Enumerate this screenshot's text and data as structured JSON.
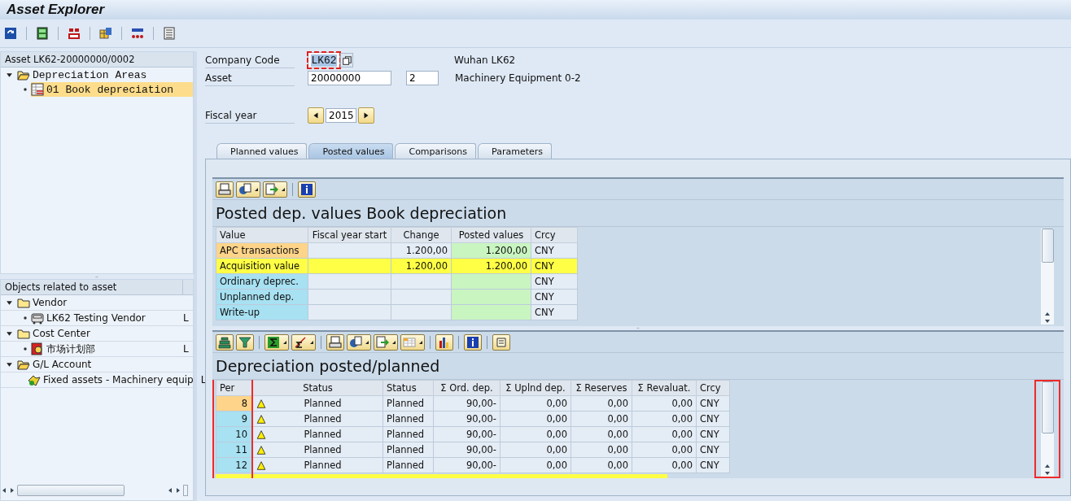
{
  "window": {
    "title": "Asset Explorer"
  },
  "asset_tree": {
    "header": "Asset LK62-20000000/0002",
    "items": [
      {
        "label": "Depreciation Areas",
        "kind": "folder-open",
        "expanded": true,
        "selected": false,
        "children": [
          {
            "label": "01 Book depreciation",
            "kind": "table",
            "selected": true
          }
        ]
      }
    ]
  },
  "related_tree": {
    "header": "Objects related to asset",
    "items": [
      {
        "label": "Vendor",
        "kind": "folder",
        "expanded": true,
        "children": [
          {
            "label": "LK62 Testing Vendor",
            "kind": "vendor",
            "column_2": "L"
          }
        ]
      },
      {
        "label": "Cost Center",
        "kind": "folder",
        "expanded": true,
        "children": [
          {
            "label": "市场计划部",
            "kind": "cost-center",
            "column_2": "L"
          }
        ]
      },
      {
        "label": "G/L Account",
        "kind": "folder-open",
        "expanded": true,
        "children": [
          {
            "label": "Fixed assets - Machinery equip",
            "kind": "account",
            "column_2": "L"
          }
        ]
      }
    ]
  },
  "company_code": {
    "label": "Company Code",
    "value": "LK62",
    "focused": true,
    "description": "Wuhan LK62"
  },
  "asset": {
    "label": "Asset",
    "value": "20000000",
    "subnumber": "2",
    "description": "Machinery Equipment 0-2"
  },
  "fiscal_year": {
    "label": "Fiscal year",
    "value": "2015"
  },
  "tabs": [
    {
      "label": "Planned values",
      "selected": false
    },
    {
      "label": "Posted values",
      "selected": true
    },
    {
      "label": "Comparisons",
      "selected": false
    },
    {
      "label": "Parameters",
      "selected": false
    }
  ],
  "posted_grid": {
    "title": "Posted dep. values Book depreciation",
    "columns": [
      {
        "label": "Value",
        "kind": "key"
      },
      {
        "label": "Fiscal year start",
        "kind": "number"
      },
      {
        "label": "Change",
        "kind": "number"
      },
      {
        "label": "Posted values",
        "kind": "result"
      },
      {
        "label": "Crcy",
        "kind": "text"
      }
    ],
    "rows": [
      {
        "kind": "normal",
        "selected": true,
        "cells": [
          "APC transactions",
          "",
          "1.200,00",
          "1.200,00",
          "CNY"
        ]
      },
      {
        "kind": "total",
        "selected": false,
        "cells": [
          "Acquisition value",
          "",
          "1.200,00",
          "1.200,00",
          "CNY"
        ]
      },
      {
        "kind": "normal",
        "selected": false,
        "cells": [
          "Ordinary deprec.",
          "",
          "",
          "",
          "CNY"
        ]
      },
      {
        "kind": "normal",
        "selected": false,
        "cells": [
          "Unplanned dep.",
          "",
          "",
          "",
          "CNY"
        ]
      },
      {
        "kind": "normal",
        "selected": false,
        "cells": [
          "Write-up",
          "",
          "",
          "",
          "CNY"
        ]
      }
    ]
  },
  "period_grid": {
    "title": "Depreciation posted/planned",
    "columns": [
      {
        "label": "Per",
        "kind": "key"
      },
      {
        "label": "Status",
        "kind": "status"
      },
      {
        "label": "Status",
        "kind": "text"
      },
      {
        "label": "Σ Ord. dep.",
        "kind": "number"
      },
      {
        "label": "Σ Uplnd dep.",
        "kind": "number"
      },
      {
        "label": "Σ Reserves",
        "kind": "number"
      },
      {
        "label": "Σ Revaluat.",
        "kind": "number"
      },
      {
        "label": "Crcy",
        "kind": "text"
      }
    ],
    "rows": [
      {
        "selected": true,
        "kind": "warning",
        "cells": [
          "8",
          "Planned",
          "Planned",
          "90,00-",
          "0,00",
          "0,00",
          "0,00",
          "CNY"
        ]
      },
      {
        "selected": false,
        "kind": "warning",
        "cells": [
          "9",
          "Planned",
          "Planned",
          "90,00-",
          "0,00",
          "0,00",
          "0,00",
          "CNY"
        ]
      },
      {
        "selected": false,
        "kind": "warning",
        "cells": [
          "10",
          "Planned",
          "Planned",
          "90,00-",
          "0,00",
          "0,00",
          "0,00",
          "CNY"
        ]
      },
      {
        "selected": false,
        "kind": "warning",
        "cells": [
          "11",
          "Planned",
          "Planned",
          "90,00-",
          "0,00",
          "0,00",
          "0,00",
          "CNY"
        ]
      },
      {
        "selected": false,
        "kind": "warning",
        "cells": [
          "12",
          "Planned",
          "Planned",
          "90,00-",
          "0,00",
          "0,00",
          "0,00",
          "CNY"
        ]
      }
    ]
  }
}
